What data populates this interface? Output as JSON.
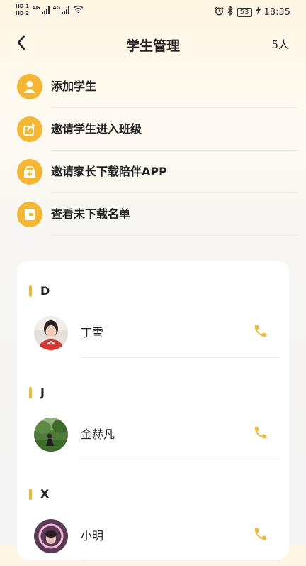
{
  "status_bar": {
    "hd1": "HD 1",
    "hd2": "HD 2",
    "net1": "4G",
    "net2": "4G",
    "battery": "53",
    "time": "18:35",
    "icons": [
      "alarm-icon",
      "bluetooth-icon",
      "battery-icon",
      "charging-icon",
      "wifi-icon"
    ]
  },
  "header": {
    "title": "学生管理",
    "count": "5人",
    "back_icon": "chevron-left-icon"
  },
  "menu": {
    "items": [
      {
        "label": "添加学生",
        "icon": "person-icon"
      },
      {
        "label": "邀请学生进入班级",
        "icon": "share-icon"
      },
      {
        "label": "邀请家长下载陪伴APP",
        "icon": "download-icon"
      },
      {
        "label": "查看未下载名单",
        "icon": "list-icon"
      }
    ]
  },
  "students": {
    "groups": [
      {
        "letter": "D",
        "name": "丁雪"
      },
      {
        "letter": "J",
        "name": "金赫凡"
      },
      {
        "letter": "X",
        "name": "小明"
      }
    ]
  },
  "colors": {
    "accent": "#f6b632",
    "background_top": "#fff6e3",
    "background": "#f4f4f4",
    "card": "#ffffff"
  }
}
